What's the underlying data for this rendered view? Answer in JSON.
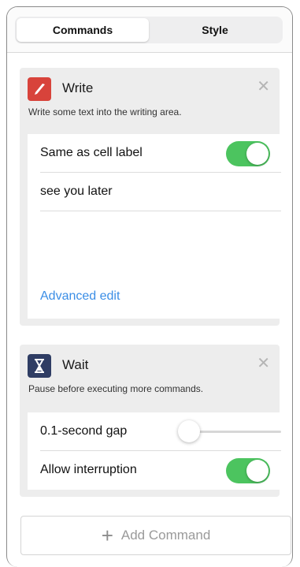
{
  "tabs": [
    {
      "label": "Commands",
      "active": true
    },
    {
      "label": "Style",
      "active": false
    }
  ],
  "write_card": {
    "title": "Write",
    "icon": "pen-icon",
    "icon_color": "#d8433b",
    "description": "Write some text into the writing area.",
    "toggle_label": "Same as cell label",
    "toggle_on": true,
    "text_value": "see you later",
    "link_label": "Advanced edit"
  },
  "wait_card": {
    "title": "Wait",
    "icon": "hourglass-icon",
    "icon_color": "#2f3d64",
    "description": "Pause before executing more commands.",
    "slider_label": "0.1-second gap",
    "slider_value": 0.1,
    "toggle_label": "Allow interruption",
    "toggle_on": true
  },
  "add_button_label": "Add Command",
  "colors": {
    "toggle_on": "#4cc45f",
    "link": "#3b8ee6"
  }
}
